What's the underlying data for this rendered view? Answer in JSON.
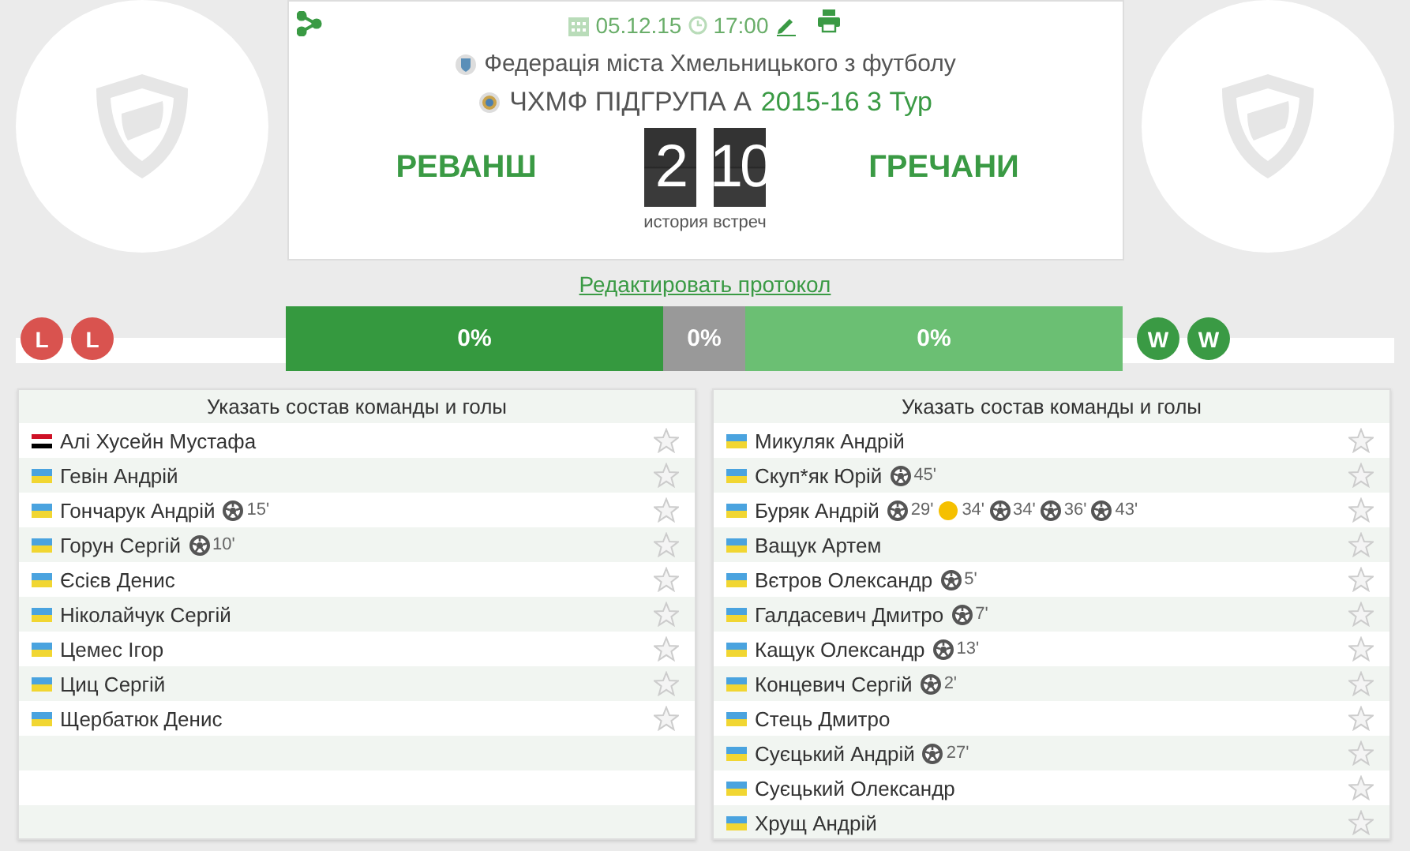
{
  "match": {
    "date": "05.12.15",
    "time": "17:00",
    "federation": "Федерація міста Хмельницького з футболу",
    "competition": "ЧХМФ ПІДГРУПА А",
    "round": "2015-16 3 Тур",
    "home_team": "РЕВАНШ",
    "away_team": "ГРЕЧАНИ",
    "home_score": "2",
    "away_score": "10",
    "history_link": "история встреч"
  },
  "edit_link": "Редактировать протокол",
  "home_form": [
    {
      "result": "L",
      "kind": "loss"
    },
    {
      "result": "L",
      "kind": "loss"
    }
  ],
  "away_form": [
    {
      "result": "W",
      "kind": "win"
    },
    {
      "result": "W",
      "kind": "win"
    }
  ],
  "stats": [
    {
      "label": "0%",
      "kind": "home"
    },
    {
      "label": "0%",
      "kind": "draw"
    },
    {
      "label": "0%",
      "kind": "away"
    }
  ],
  "lineups": [
    {
      "title": "Указать состав команды и голы",
      "players": [
        {
          "name": "Алі Хусейн Мустафа",
          "kind": "egypt"
        },
        {
          "name": "Гевін Андрій",
          "kind": "ukraine"
        },
        {
          "name": "Гончарук Андрій",
          "kind": "ukraine",
          "events": [
            {
              "kind": "goal",
              "minute": "15'"
            }
          ]
        },
        {
          "name": "Горун Сергій",
          "kind": "ukraine",
          "events": [
            {
              "kind": "goal",
              "minute": "10'"
            }
          ]
        },
        {
          "name": "Єсієв Денис",
          "kind": "ukraine"
        },
        {
          "name": "Ніколайчук Сергій",
          "kind": "ukraine"
        },
        {
          "name": "Цемес Ігор",
          "kind": "ukraine"
        },
        {
          "name": "Циц Сергій",
          "kind": "ukraine"
        },
        {
          "name": "Щербатюк Денис",
          "kind": "ukraine"
        }
      ]
    },
    {
      "title": "Указать состав команды и голы",
      "players": [
        {
          "name": "Микуляк Андрій",
          "kind": "ukraine"
        },
        {
          "name": "Скуп*як Юрій",
          "kind": "ukraine",
          "events": [
            {
              "kind": "goal",
              "minute": "45'"
            }
          ]
        },
        {
          "name": "Буряк Андрій",
          "kind": "ukraine",
          "events": [
            {
              "kind": "goal",
              "minute": "29'"
            },
            {
              "kind": "yellow_card",
              "minute": "34'"
            },
            {
              "kind": "goal",
              "minute": "34'"
            },
            {
              "kind": "goal",
              "minute": "36'"
            },
            {
              "kind": "goal",
              "minute": "43'"
            }
          ]
        },
        {
          "name": "Ващук Артем",
          "kind": "ukraine"
        },
        {
          "name": "Вєтров Олександр",
          "kind": "ukraine",
          "events": [
            {
              "kind": "goal",
              "minute": "5'"
            }
          ]
        },
        {
          "name": "Галдасевич Дмитро",
          "kind": "ukraine",
          "events": [
            {
              "kind": "goal",
              "minute": "7'"
            }
          ]
        },
        {
          "name": "Кащук Олександр",
          "kind": "ukraine",
          "events": [
            {
              "kind": "goal",
              "minute": "13'"
            }
          ]
        },
        {
          "name": "Концевич Сергій",
          "kind": "ukraine",
          "events": [
            {
              "kind": "goal",
              "minute": "2'"
            }
          ]
        },
        {
          "name": "Стець Дмитро",
          "kind": "ukraine"
        },
        {
          "name": "Суєцький Андрій",
          "kind": "ukraine",
          "events": [
            {
              "kind": "goal",
              "minute": "27'"
            }
          ]
        },
        {
          "name": "Суєцький Олександр",
          "kind": "ukraine"
        },
        {
          "name": "Хрущ Андрій",
          "kind": "ukraine"
        }
      ]
    }
  ]
}
